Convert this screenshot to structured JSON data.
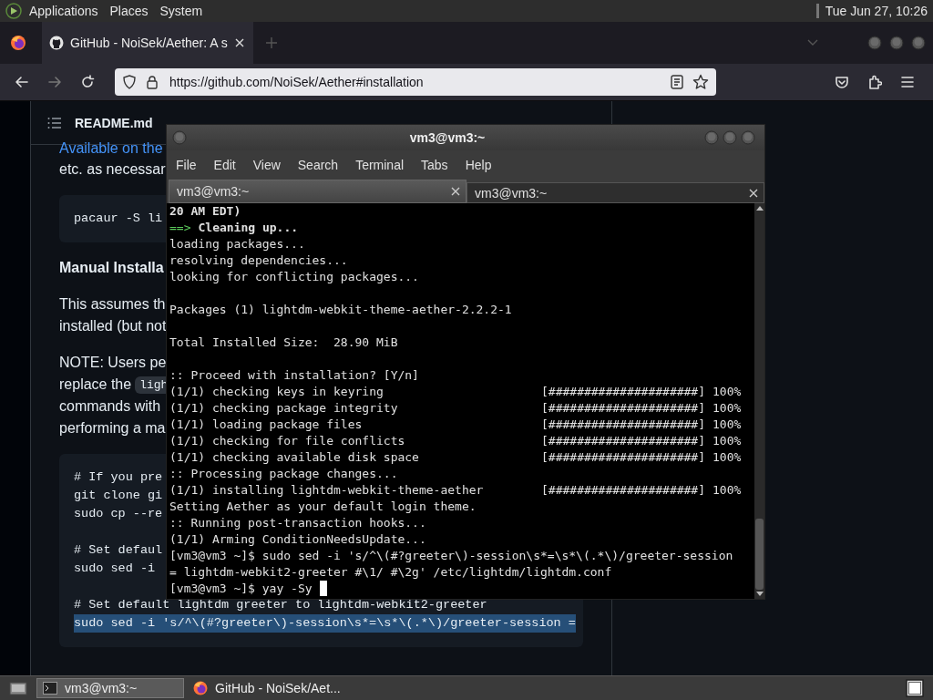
{
  "top_panel": {
    "menus": [
      "Applications",
      "Places",
      "System"
    ],
    "clock": "Tue Jun 27, 10:26"
  },
  "browser": {
    "tabs": [
      {
        "title": "GitHub - NoiSek/Aether: A s",
        "selected": true
      }
    ],
    "url": "https://github.com/NoiSek/Aether#installation"
  },
  "readme": {
    "title": "README.md",
    "blocks": [
      {
        "kind": "link",
        "text": "Available on the"
      },
      {
        "kind": "text",
        "text": "etc. as necessar"
      },
      {
        "kind": "code",
        "groups": [
          [
            {
              "text": "pacaur -S li",
              "selected": false
            }
          ]
        ]
      },
      {
        "kind": "heading",
        "text": "Manual Installa"
      },
      {
        "kind": "lines",
        "lines": [
          {
            "text": "This assumes th"
          },
          {
            "text": "installed (but not"
          }
        ]
      },
      {
        "kind": "lines",
        "lines": [
          {
            "text": "NOTE: Users pe"
          },
          {
            "text": "replace the",
            "code": "ligh"
          },
          {
            "text": "commands with"
          },
          {
            "text": "performing a ma"
          }
        ]
      },
      {
        "kind": "code",
        "groups": [
          [
            {
              "text": "# If you pre",
              "selected": false
            },
            {
              "text": "git clone gi",
              "selected": false
            },
            {
              "text": "sudo cp --re",
              "selected": false
            }
          ],
          [
            {
              "text": "# Set defaul",
              "selected": false
            },
            {
              "text": "sudo sed -i",
              "selected": false
            }
          ],
          [
            {
              "text": "# Set default lightdm greeter to lightdm-webkit2-greeter",
              "selected": false
            },
            {
              "text": "sudo sed -i 's/^\\(#?greeter\\)-session\\s*=\\s*\\(.*\\)/greeter-session =",
              "selected": true
            }
          ]
        ]
      }
    ]
  },
  "terminal": {
    "title": "vm3@vm3:~",
    "menus": [
      "File",
      "Edit",
      "View",
      "Search",
      "Terminal",
      "Tabs",
      "Help"
    ],
    "tabs": [
      {
        "title": "vm3@vm3:~",
        "selected": true
      },
      {
        "title": "vm3@vm3:~",
        "selected": false
      }
    ],
    "lines": [
      {
        "kind": "bold",
        "text": "20 AM EDT)"
      },
      {
        "kind": "arrow",
        "prefix": "==>",
        "text": "Cleaning up..."
      },
      {
        "kind": "plain",
        "text": "loading packages..."
      },
      {
        "kind": "plain",
        "text": "resolving dependencies..."
      },
      {
        "kind": "plain",
        "text": "looking for conflicting packages..."
      },
      {
        "kind": "blank"
      },
      {
        "kind": "plain",
        "text": "Packages (1) lightdm-webkit-theme-aether-2.2.2-1"
      },
      {
        "kind": "blank"
      },
      {
        "kind": "plain",
        "text": "Total Installed Size:  28.90 MiB"
      },
      {
        "kind": "blank"
      },
      {
        "kind": "plain",
        "text": ":: Proceed with installation? [Y/n]"
      },
      {
        "kind": "progress",
        "text": "(1/1) checking keys in keyring",
        "bar": "[#####################]",
        "percent": "100%"
      },
      {
        "kind": "progress",
        "text": "(1/1) checking package integrity",
        "bar": "[#####################]",
        "percent": "100%"
      },
      {
        "kind": "progress",
        "text": "(1/1) loading package files",
        "bar": "[#####################]",
        "percent": "100%"
      },
      {
        "kind": "progress",
        "text": "(1/1) checking for file conflicts",
        "bar": "[#####################]",
        "percent": "100%"
      },
      {
        "kind": "progress",
        "text": "(1/1) checking available disk space",
        "bar": "[#####################]",
        "percent": "100%"
      },
      {
        "kind": "plain",
        "text": ":: Processing package changes..."
      },
      {
        "kind": "progress",
        "text": "(1/1) installing lightdm-webkit-theme-aether",
        "bar": "[#####################]",
        "percent": "100%"
      },
      {
        "kind": "plain",
        "text": "Setting Aether as your default login theme."
      },
      {
        "kind": "plain",
        "text": ":: Running post-transaction hooks..."
      },
      {
        "kind": "plain",
        "text": "(1/1) Arming ConditionNeedsUpdate..."
      },
      {
        "kind": "plain",
        "text": "[vm3@vm3 ~]$ sudo sed -i 's/^\\(#?greeter\\)-session\\s*=\\s*\\(.*\\)/greeter-session"
      },
      {
        "kind": "plain",
        "text": "= lightdm-webkit2-greeter #\\1/ #\\2g' /etc/lightdm/lightdm.conf"
      },
      {
        "kind": "prompt",
        "text": "[vm3@vm3 ~]$ yay -Sy"
      }
    ]
  },
  "taskbar": {
    "tasks": [
      {
        "title": "vm3@vm3:~",
        "kind": "terminal",
        "selected": true
      },
      {
        "title": "GitHub - NoiSek/Aet...",
        "kind": "browser",
        "selected": false
      }
    ]
  }
}
